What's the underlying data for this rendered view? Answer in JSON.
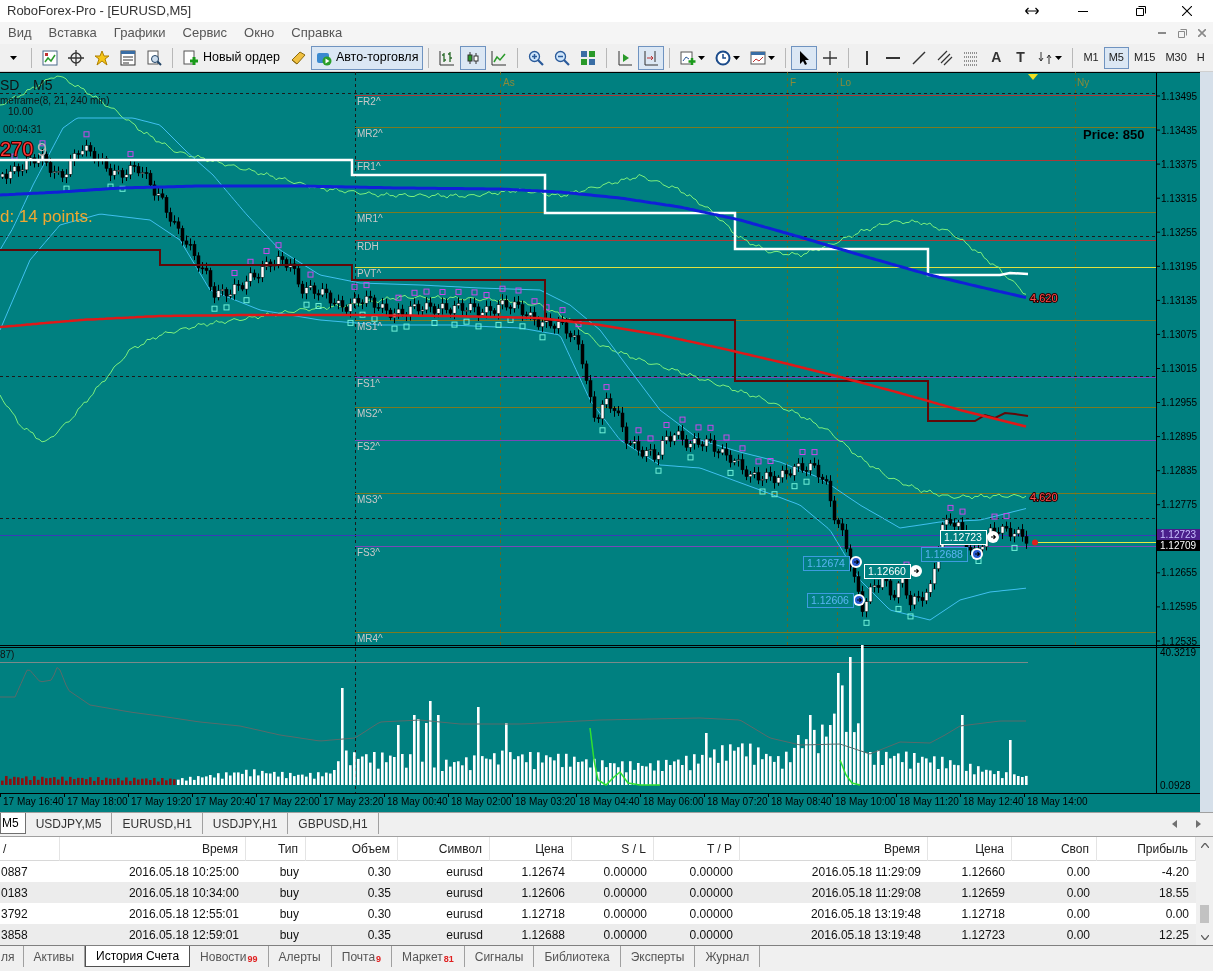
{
  "window": {
    "title": "RoboForex-Pro - [EURUSD,M5]"
  },
  "menu": [
    "Вид",
    "Вставка",
    "Графики",
    "Сервис",
    "Окно",
    "Справка"
  ],
  "toolbar": {
    "groups": [
      [
        {
          "kind": "icon",
          "pressed": false
        }
      ],
      [
        {
          "kind": "icon",
          "pressed": false
        },
        {
          "kind": "icon",
          "pressed": false
        },
        {
          "kind": "icon",
          "pressed": false
        },
        {
          "kind": "icon",
          "pressed": false
        },
        {
          "kind": "icon",
          "pressed": false
        }
      ],
      [
        {
          "kind": "button",
          "label": "Новый ордер",
          "pressed": false
        },
        {
          "kind": "icon",
          "pressed": false
        },
        {
          "kind": "button",
          "label": "Авто-торговля",
          "pressed": true
        }
      ],
      [
        {
          "kind": "icon",
          "pressed": false
        },
        {
          "kind": "icon",
          "pressed": true
        },
        {
          "kind": "icon",
          "pressed": false
        }
      ],
      [
        {
          "kind": "icon",
          "pressed": false
        },
        {
          "kind": "icon",
          "pressed": false
        },
        {
          "kind": "icon",
          "pressed": false
        }
      ],
      [
        {
          "kind": "icon",
          "pressed": false
        },
        {
          "kind": "icon",
          "pressed": true
        }
      ],
      [
        {
          "kind": "icon",
          "pressed": false
        },
        {
          "kind": "icon",
          "pressed": false
        },
        {
          "kind": "icon",
          "pressed": false
        }
      ],
      [
        {
          "kind": "icon",
          "pressed": true
        },
        {
          "kind": "icon",
          "pressed": false
        }
      ],
      [
        {
          "kind": "icon",
          "pressed": false
        },
        {
          "kind": "icon",
          "pressed": false
        },
        {
          "kind": "icon",
          "pressed": false
        },
        {
          "kind": "icon",
          "pressed": false
        },
        {
          "kind": "icon",
          "pressed": false
        },
        {
          "kind": "glyph",
          "text": "A",
          "pressed": false
        },
        {
          "kind": "glyph",
          "text": "T",
          "pressed": false
        },
        {
          "kind": "icon",
          "pressed": false
        }
      ]
    ],
    "timeframes": [
      {
        "label": "M1",
        "selected": false
      },
      {
        "label": "M5",
        "selected": true
      },
      {
        "label": "M15",
        "selected": false
      },
      {
        "label": "M30",
        "selected": false
      },
      {
        "label": "H",
        "selected": false
      }
    ]
  },
  "chart": {
    "symbol": "SD",
    "period": "M5",
    "caption": "meframe(8, 21, 240 min)",
    "info_lines": [
      "10.00",
      "00:04:31"
    ],
    "counter": "270",
    "counter_suffix": "9",
    "spread_note": "d: 14 points.",
    "price_note": "Price: 850",
    "sessions": [
      "As",
      "F",
      "Lo",
      "Ny"
    ],
    "pivots": [
      "FR2^",
      "MR2^",
      "FR1^",
      "MR1^",
      "RDH",
      "PVT^",
      "MS1^",
      "FS1^",
      "MS2^",
      "FS2^",
      "MS3^",
      "FS3^",
      "MR4^"
    ],
    "targets": [
      "4.620",
      "4.620"
    ],
    "trade_labels": [
      {
        "kind": "open",
        "text": "1.12674"
      },
      {
        "kind": "open",
        "text": "1.12606"
      },
      {
        "kind": "open",
        "text": "1.12688"
      },
      {
        "kind": "close",
        "text": "1.12660"
      },
      {
        "kind": "close",
        "text": "1.12723"
      }
    ],
    "price_axis": [
      "1.13495",
      "1.13435",
      "1.13375",
      "1.13315",
      "1.13255",
      "1.13195",
      "1.13135",
      "1.13075",
      "1.13015",
      "1.12955",
      "1.12895",
      "1.12835",
      "1.12775",
      "1.12655",
      "1.12595",
      "1.12535"
    ],
    "bid_tag": "1.12723",
    "ask_tag": "1.12709"
  },
  "indicator": {
    "caption": "87)",
    "scale_max": "40.3219",
    "scale_min": "0.0928"
  },
  "time_axis": [
    "17 May 16:40",
    "17 May 18:00",
    "17 May 19:20",
    "17 May 20:40",
    "17 May 22:00",
    "17 May 23:20",
    "18 May 00:40",
    "18 May 02:00",
    "18 May 03:20",
    "18 May 04:40",
    "18 May 06:00",
    "18 May 07:20",
    "18 May 08:40",
    "18 May 10:00",
    "18 May 11:20",
    "18 May 12:40",
    "18 May 14:00"
  ],
  "chart_tabs": [
    {
      "label": "M5",
      "selected": true
    },
    {
      "label": "USDJPY,M5",
      "selected": false
    },
    {
      "label": "EURUSD,H1",
      "selected": false
    },
    {
      "label": "USDJPY,H1",
      "selected": false
    },
    {
      "label": "GBPUSD,H1",
      "selected": false
    }
  ],
  "terminal": {
    "columns": [
      "/",
      "Время",
      "Тип",
      "Объем",
      "Символ",
      "Цена",
      "S / L",
      "T / P",
      "Время",
      "Цена",
      "Своп",
      "Прибыль"
    ],
    "rows": [
      [
        "0887",
        "2016.05.18 10:25:00",
        "buy",
        "0.30",
        "eurusd",
        "1.12674",
        "0.00000",
        "0.00000",
        "2016.05.18 11:29:09",
        "1.12660",
        "0.00",
        "-4.20"
      ],
      [
        "0183",
        "2016.05.18 10:34:00",
        "buy",
        "0.35",
        "eurusd",
        "1.12606",
        "0.00000",
        "0.00000",
        "2016.05.18 11:29:08",
        "1.12659",
        "0.00",
        "18.55"
      ],
      [
        "3792",
        "2016.05.18 12:55:01",
        "buy",
        "0.30",
        "eurusd",
        "1.12718",
        "0.00000",
        "0.00000",
        "2016.05.18 13:19:48",
        "1.12718",
        "0.00",
        "0.00"
      ],
      [
        "3858",
        "2016.05.18 12:59:01",
        "buy",
        "0.35",
        "eurusd",
        "1.12688",
        "0.00000",
        "0.00000",
        "2016.05.18 13:19:48",
        "1.12723",
        "0.00",
        "12.25"
      ]
    ],
    "tabs": [
      {
        "label": "ля",
        "selected": false
      },
      {
        "label": "Активы",
        "selected": false
      },
      {
        "label": "История Счета",
        "selected": true
      },
      {
        "label": "Новости",
        "badge": "99",
        "selected": false
      },
      {
        "label": "Алерты",
        "selected": false
      },
      {
        "label": "Почта",
        "badge": "9",
        "selected": false
      },
      {
        "label": "Маркет",
        "badge": "81",
        "selected": false
      },
      {
        "label": "Сигналы",
        "selected": false
      },
      {
        "label": "Библиотека",
        "selected": false
      },
      {
        "label": "Эксперты",
        "selected": false
      },
      {
        "label": "Журнал",
        "selected": false
      }
    ]
  }
}
